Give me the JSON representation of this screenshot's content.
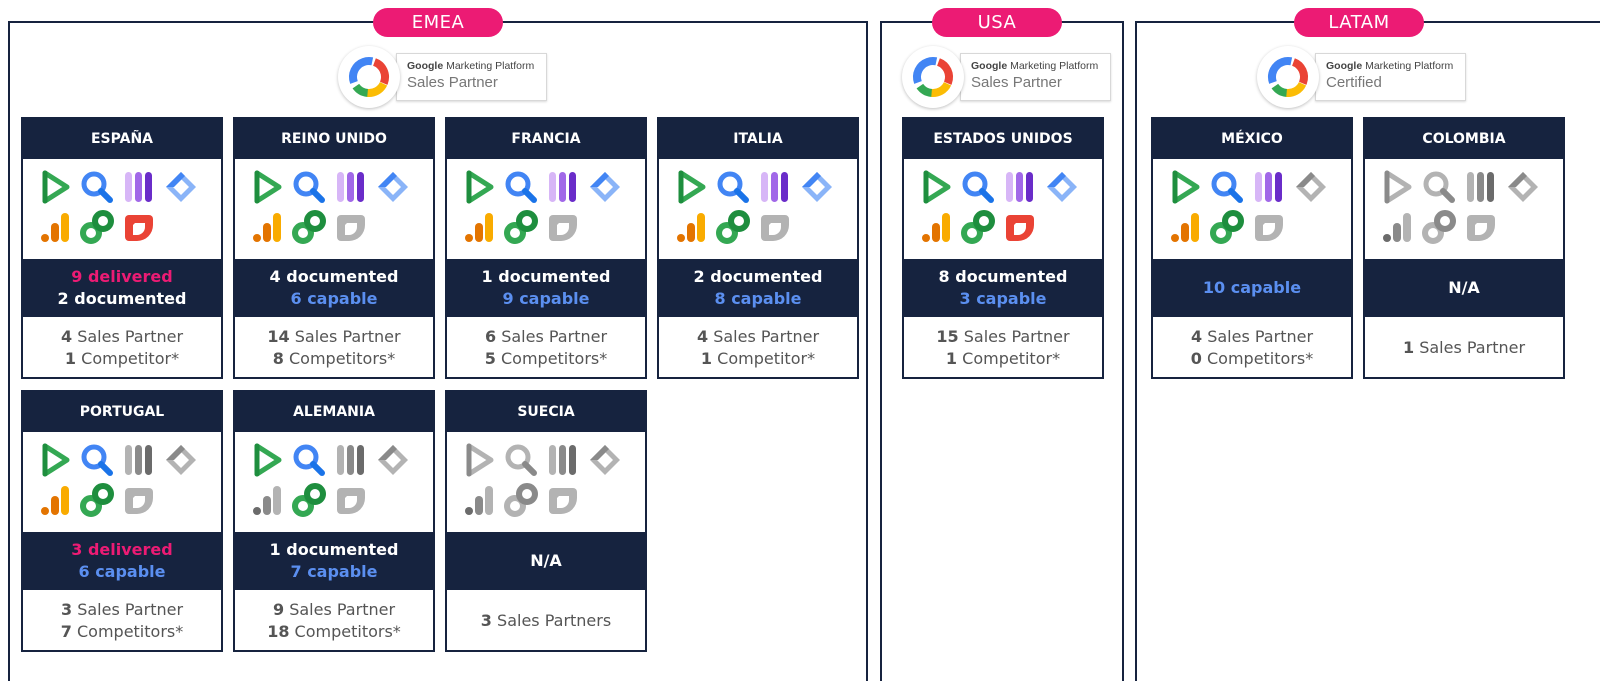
{
  "regions": [
    {
      "name": "EMEA",
      "badge": {
        "brand": "Google",
        "platform": "Marketing Platform",
        "tier": "Sales Partner"
      }
    },
    {
      "name": "USA",
      "badge": {
        "brand": "Google",
        "platform": "Marketing Platform",
        "tier": "Sales Partner"
      }
    },
    {
      "name": "LATAM",
      "badge": {
        "brand": "Google",
        "platform": "Marketing Platform",
        "tier": "Certified"
      }
    }
  ],
  "countries": [
    {
      "name": "ESPAÑA",
      "status": [
        {
          "text": "9 delivered",
          "kind": "delivered"
        },
        {
          "text": "2 documented",
          "kind": "documented"
        }
      ],
      "counts": [
        {
          "num": "4",
          "label": "Sales Partner"
        },
        {
          "num": "1",
          "label": "Competitor*"
        }
      ],
      "icons": [
        "display-video-360",
        "search-ads-360",
        "campaign-manager-360",
        "tag-manager",
        "analytics",
        "optimize",
        "looker-studio"
      ],
      "active": [
        true,
        true,
        true,
        true,
        true,
        true,
        true
      ]
    },
    {
      "name": "REINO UNIDO",
      "status": [
        {
          "text": "4 documented",
          "kind": "documented"
        },
        {
          "text": "6 capable",
          "kind": "capable"
        }
      ],
      "counts": [
        {
          "num": "14",
          "label": "Sales Partner"
        },
        {
          "num": "8",
          "label": "Competitors*"
        }
      ],
      "icons": [
        "display-video-360",
        "search-ads-360",
        "campaign-manager-360",
        "tag-manager",
        "analytics",
        "optimize",
        "looker-studio"
      ],
      "active": [
        true,
        true,
        true,
        true,
        true,
        true,
        false
      ]
    },
    {
      "name": "FRANCIA",
      "status": [
        {
          "text": "1 documented",
          "kind": "documented"
        },
        {
          "text": "9 capable",
          "kind": "capable"
        }
      ],
      "counts": [
        {
          "num": "6",
          "label": "Sales Partner"
        },
        {
          "num": "5",
          "label": "Competitors*"
        }
      ],
      "icons": [
        "display-video-360",
        "search-ads-360",
        "campaign-manager-360",
        "tag-manager",
        "analytics",
        "optimize",
        "looker-studio"
      ],
      "active": [
        true,
        true,
        true,
        true,
        true,
        true,
        false
      ]
    },
    {
      "name": "ITALIA",
      "status": [
        {
          "text": "2 documented",
          "kind": "documented"
        },
        {
          "text": "8 capable",
          "kind": "capable"
        }
      ],
      "counts": [
        {
          "num": "4",
          "label": "Sales Partner"
        },
        {
          "num": "1",
          "label": "Competitor*"
        }
      ],
      "icons": [
        "display-video-360",
        "search-ads-360",
        "campaign-manager-360",
        "tag-manager",
        "analytics",
        "optimize",
        "looker-studio"
      ],
      "active": [
        true,
        true,
        true,
        true,
        true,
        true,
        false
      ]
    },
    {
      "name": "ESTADOS UNIDOS",
      "status": [
        {
          "text": "8 documented",
          "kind": "documented"
        },
        {
          "text": "3 capable",
          "kind": "capable"
        }
      ],
      "counts": [
        {
          "num": "15",
          "label": "Sales Partner"
        },
        {
          "num": "1",
          "label": "Competitor*"
        }
      ],
      "icons": [
        "display-video-360",
        "search-ads-360",
        "campaign-manager-360",
        "tag-manager",
        "analytics",
        "optimize",
        "looker-studio"
      ],
      "active": [
        true,
        true,
        true,
        true,
        true,
        true,
        true
      ]
    },
    {
      "name": "MÉXICO",
      "status": [
        {
          "text": "10 capable",
          "kind": "capable"
        }
      ],
      "counts": [
        {
          "num": "4",
          "label": "Sales Partner"
        },
        {
          "num": "0",
          "label": "Competitors*"
        }
      ],
      "icons": [
        "display-video-360",
        "search-ads-360",
        "campaign-manager-360",
        "tag-manager",
        "analytics",
        "optimize",
        "looker-studio"
      ],
      "active": [
        true,
        true,
        true,
        false,
        true,
        true,
        false
      ]
    },
    {
      "name": "COLOMBIA",
      "status": [
        {
          "text": "N/A",
          "kind": "na"
        }
      ],
      "counts": [
        {
          "num": "1",
          "label": "Sales Partner"
        }
      ],
      "icons": [
        "display-video-360",
        "search-ads-360",
        "campaign-manager-360",
        "tag-manager",
        "analytics",
        "optimize",
        "looker-studio"
      ],
      "active": [
        false,
        false,
        false,
        false,
        false,
        false,
        false
      ]
    },
    {
      "name": "PORTUGAL",
      "status": [
        {
          "text": "3 delivered",
          "kind": "delivered"
        },
        {
          "text": "6 capable",
          "kind": "capable"
        }
      ],
      "counts": [
        {
          "num": "3",
          "label": "Sales Partner"
        },
        {
          "num": "7",
          "label": "Competitors*"
        }
      ],
      "icons": [
        "display-video-360",
        "search-ads-360",
        "campaign-manager-360",
        "tag-manager",
        "analytics",
        "optimize",
        "looker-studio"
      ],
      "active": [
        true,
        true,
        false,
        false,
        true,
        true,
        false
      ]
    },
    {
      "name": "ALEMANIA",
      "status": [
        {
          "text": "1 documented",
          "kind": "documented"
        },
        {
          "text": "7 capable",
          "kind": "capable"
        }
      ],
      "counts": [
        {
          "num": "9",
          "label": "Sales Partner"
        },
        {
          "num": "18",
          "label": "Competitors*"
        }
      ],
      "icons": [
        "display-video-360",
        "search-ads-360",
        "campaign-manager-360",
        "tag-manager",
        "analytics",
        "optimize",
        "looker-studio"
      ],
      "active": [
        true,
        true,
        false,
        false,
        false,
        true,
        false
      ]
    },
    {
      "name": "SUECIA",
      "status": [
        {
          "text": "N/A",
          "kind": "na"
        }
      ],
      "counts": [
        {
          "num": "3",
          "label": "Sales Partners"
        }
      ],
      "icons": [
        "display-video-360",
        "search-ads-360",
        "campaign-manager-360",
        "tag-manager",
        "analytics",
        "optimize",
        "looker-studio"
      ],
      "active": [
        false,
        false,
        false,
        false,
        false,
        false,
        false
      ]
    }
  ],
  "colors": {
    "navy": "#16233f",
    "pink": "#ec1b74",
    "capable_blue": "#5b8ff0"
  }
}
